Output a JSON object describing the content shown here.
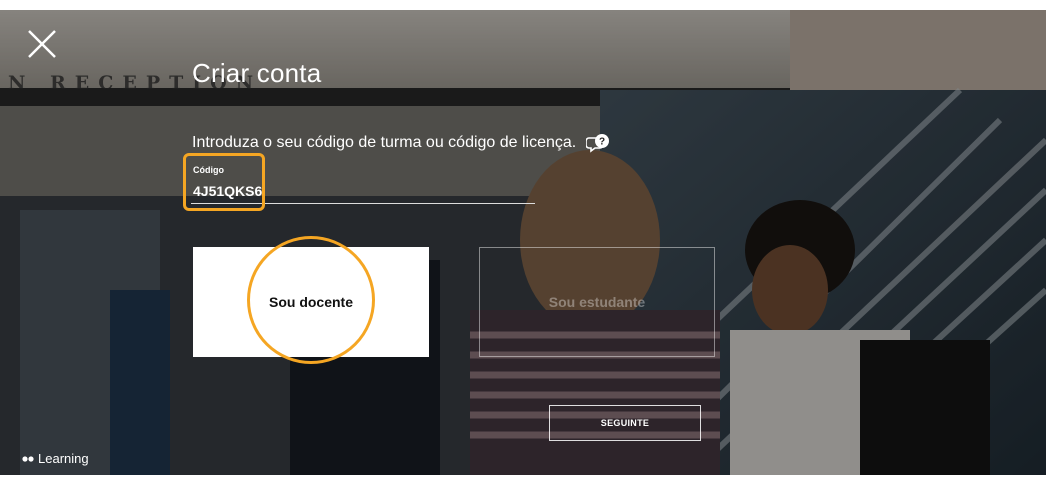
{
  "header": {
    "title": "Criar conta",
    "instruction": "Introduza o seu código de turma ou código de licença."
  },
  "code_field": {
    "label": "Código",
    "value": "4J51QKS6"
  },
  "roles": {
    "teacher_label": "Sou docente",
    "student_label": "Sou estudante"
  },
  "actions": {
    "next_label": "SEGUINTE"
  },
  "footer": {
    "brand": "Learning"
  },
  "background_sign": {
    "text": "N RECEPTION"
  },
  "colors": {
    "highlight": "#f5a623",
    "text": "#ffffff",
    "card": "#ffffff"
  },
  "icons": {
    "close": "close-icon",
    "help": "help-chat-icon",
    "brand": "brand-dots-icon"
  }
}
